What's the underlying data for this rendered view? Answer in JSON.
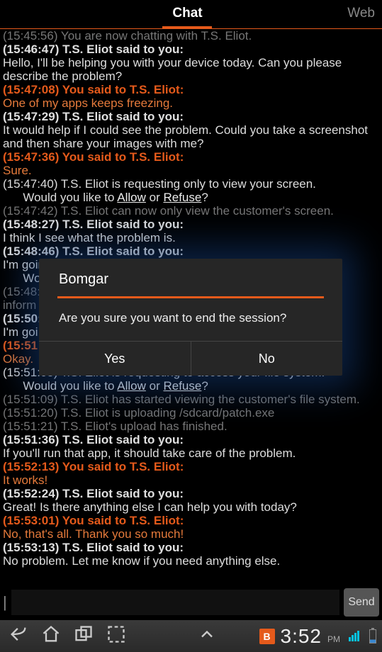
{
  "tabs": {
    "chat": "Chat",
    "web": "Web"
  },
  "chat": [
    {
      "cls": "sys",
      "t": "(15:45:56) You are now chatting with T.S. Eliot."
    },
    {
      "cls": "rep-head",
      "t": "(15:46:47) T.S. Eliot said to you:"
    },
    {
      "cls": "rep-body",
      "t": "Hello, I'll be helping you with your device today. Can you please describe the problem?"
    },
    {
      "cls": "you-head",
      "t": "(15:47:08) You said to T.S. Eliot:"
    },
    {
      "cls": "you-body",
      "t": "One of my apps keeps freezing."
    },
    {
      "cls": "rep-head",
      "t": "(15:47:29) T.S. Eliot said to you:"
    },
    {
      "cls": "rep-body",
      "t": "It would help if I could see the problem. Could you take a screenshot and then share your images with me?"
    },
    {
      "cls": "you-head",
      "t": "(15:47:36) You said to T.S. Eliot:"
    },
    {
      "cls": "you-body",
      "t": "Sure."
    },
    {
      "cls": "rep-body",
      "t": "(15:47:40) T.S. Eliot is requesting only to view your screen."
    },
    {
      "cls": "rep-body",
      "html": true,
      "t": "      Would you like to <span class='link'>Allow</span> or <span class='link'>Refuse</span>?"
    },
    {
      "cls": "sys",
      "t": "(15:47:42) T.S. Eliot can now only view the customer's screen."
    },
    {
      "cls": "rep-head",
      "t": "(15:48:27) T.S. Eliot said to you:"
    },
    {
      "cls": "rep-body",
      "t": "I think I see what the problem is."
    },
    {
      "cls": "rep-head",
      "t": "(15:48:46) T.S. Eliot said to you:"
    },
    {
      "cls": "rep-body",
      "t": "I'm going to look at your system information to make sure."
    },
    {
      "cls": "rep-body",
      "t": "      Would"
    },
    {
      "cls": "sys",
      "t": "(15:48:"
    },
    {
      "cls": "sys",
      "t": "inform"
    },
    {
      "cls": "rep-head",
      "t": "(15:50:"
    },
    {
      "cls": "rep-body",
      "t": "I'm goi"
    },
    {
      "cls": "you-head",
      "t": "(15:51"
    },
    {
      "cls": "you-body",
      "t": "Okay."
    },
    {
      "cls": "rep-body",
      "t": "(15:51:05) T.S. Eliot is requesting to access your file system."
    },
    {
      "cls": "rep-body",
      "html": true,
      "t": "      Would you like to <span class='link'>Allow</span> or <span class='link'>Refuse</span>?"
    },
    {
      "cls": "sys",
      "t": "(15:51:09) T.S. Eliot has started viewing the customer's file system."
    },
    {
      "cls": "sys",
      "t": "(15:51:20) T.S. Eliot is uploading /sdcard/patch.exe"
    },
    {
      "cls": "sys",
      "t": "(15:51:21) T.S. Eliot's upload has finished."
    },
    {
      "cls": "rep-head",
      "t": "(15:51:36) T.S. Eliot said to you:"
    },
    {
      "cls": "rep-body",
      "t": "If you'll run that app, it should take care of the problem."
    },
    {
      "cls": "you-head",
      "t": "(15:52:13) You said to T.S. Eliot:"
    },
    {
      "cls": "you-body",
      "t": "It works!"
    },
    {
      "cls": "rep-head",
      "t": "(15:52:24) T.S. Eliot said to you:"
    },
    {
      "cls": "rep-body",
      "t": "Great! Is there anything else I can help you with today?"
    },
    {
      "cls": "you-head",
      "t": "(15:53:01) You said to T.S. Eliot:"
    },
    {
      "cls": "you-body",
      "t": "No, that's all. Thank you so much!"
    },
    {
      "cls": "rep-head",
      "t": "(15:53:13) T.S. Eliot said to you:"
    },
    {
      "cls": "rep-body",
      "t": "No problem. Let me know if you need anything else."
    }
  ],
  "input": {
    "placeholder": ""
  },
  "send": "Send",
  "dialog": {
    "title": "Bomgar",
    "message": "Are you sure you want to end the session?",
    "yes": "Yes",
    "no": "No"
  },
  "status": {
    "badge": "B",
    "time": "3:52",
    "ampm": "PM"
  }
}
